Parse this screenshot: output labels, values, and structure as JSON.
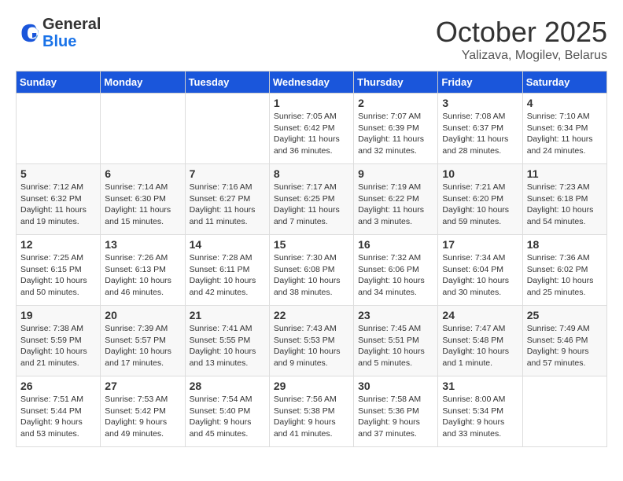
{
  "logo": {
    "general": "General",
    "blue": "Blue"
  },
  "title": "October 2025",
  "location": "Yalizava, Mogilev, Belarus",
  "days_of_week": [
    "Sunday",
    "Monday",
    "Tuesday",
    "Wednesday",
    "Thursday",
    "Friday",
    "Saturday"
  ],
  "weeks": [
    [
      {
        "day": "",
        "info": ""
      },
      {
        "day": "",
        "info": ""
      },
      {
        "day": "",
        "info": ""
      },
      {
        "day": "1",
        "info": "Sunrise: 7:05 AM\nSunset: 6:42 PM\nDaylight: 11 hours\nand 36 minutes."
      },
      {
        "day": "2",
        "info": "Sunrise: 7:07 AM\nSunset: 6:39 PM\nDaylight: 11 hours\nand 32 minutes."
      },
      {
        "day": "3",
        "info": "Sunrise: 7:08 AM\nSunset: 6:37 PM\nDaylight: 11 hours\nand 28 minutes."
      },
      {
        "day": "4",
        "info": "Sunrise: 7:10 AM\nSunset: 6:34 PM\nDaylight: 11 hours\nand 24 minutes."
      }
    ],
    [
      {
        "day": "5",
        "info": "Sunrise: 7:12 AM\nSunset: 6:32 PM\nDaylight: 11 hours\nand 19 minutes."
      },
      {
        "day": "6",
        "info": "Sunrise: 7:14 AM\nSunset: 6:30 PM\nDaylight: 11 hours\nand 15 minutes."
      },
      {
        "day": "7",
        "info": "Sunrise: 7:16 AM\nSunset: 6:27 PM\nDaylight: 11 hours\nand 11 minutes."
      },
      {
        "day": "8",
        "info": "Sunrise: 7:17 AM\nSunset: 6:25 PM\nDaylight: 11 hours\nand 7 minutes."
      },
      {
        "day": "9",
        "info": "Sunrise: 7:19 AM\nSunset: 6:22 PM\nDaylight: 11 hours\nand 3 minutes."
      },
      {
        "day": "10",
        "info": "Sunrise: 7:21 AM\nSunset: 6:20 PM\nDaylight: 10 hours\nand 59 minutes."
      },
      {
        "day": "11",
        "info": "Sunrise: 7:23 AM\nSunset: 6:18 PM\nDaylight: 10 hours\nand 54 minutes."
      }
    ],
    [
      {
        "day": "12",
        "info": "Sunrise: 7:25 AM\nSunset: 6:15 PM\nDaylight: 10 hours\nand 50 minutes."
      },
      {
        "day": "13",
        "info": "Sunrise: 7:26 AM\nSunset: 6:13 PM\nDaylight: 10 hours\nand 46 minutes."
      },
      {
        "day": "14",
        "info": "Sunrise: 7:28 AM\nSunset: 6:11 PM\nDaylight: 10 hours\nand 42 minutes."
      },
      {
        "day": "15",
        "info": "Sunrise: 7:30 AM\nSunset: 6:08 PM\nDaylight: 10 hours\nand 38 minutes."
      },
      {
        "day": "16",
        "info": "Sunrise: 7:32 AM\nSunset: 6:06 PM\nDaylight: 10 hours\nand 34 minutes."
      },
      {
        "day": "17",
        "info": "Sunrise: 7:34 AM\nSunset: 6:04 PM\nDaylight: 10 hours\nand 30 minutes."
      },
      {
        "day": "18",
        "info": "Sunrise: 7:36 AM\nSunset: 6:02 PM\nDaylight: 10 hours\nand 25 minutes."
      }
    ],
    [
      {
        "day": "19",
        "info": "Sunrise: 7:38 AM\nSunset: 5:59 PM\nDaylight: 10 hours\nand 21 minutes."
      },
      {
        "day": "20",
        "info": "Sunrise: 7:39 AM\nSunset: 5:57 PM\nDaylight: 10 hours\nand 17 minutes."
      },
      {
        "day": "21",
        "info": "Sunrise: 7:41 AM\nSunset: 5:55 PM\nDaylight: 10 hours\nand 13 minutes."
      },
      {
        "day": "22",
        "info": "Sunrise: 7:43 AM\nSunset: 5:53 PM\nDaylight: 10 hours\nand 9 minutes."
      },
      {
        "day": "23",
        "info": "Sunrise: 7:45 AM\nSunset: 5:51 PM\nDaylight: 10 hours\nand 5 minutes."
      },
      {
        "day": "24",
        "info": "Sunrise: 7:47 AM\nSunset: 5:48 PM\nDaylight: 10 hours\nand 1 minute."
      },
      {
        "day": "25",
        "info": "Sunrise: 7:49 AM\nSunset: 5:46 PM\nDaylight: 9 hours\nand 57 minutes."
      }
    ],
    [
      {
        "day": "26",
        "info": "Sunrise: 7:51 AM\nSunset: 5:44 PM\nDaylight: 9 hours\nand 53 minutes."
      },
      {
        "day": "27",
        "info": "Sunrise: 7:53 AM\nSunset: 5:42 PM\nDaylight: 9 hours\nand 49 minutes."
      },
      {
        "day": "28",
        "info": "Sunrise: 7:54 AM\nSunset: 5:40 PM\nDaylight: 9 hours\nand 45 minutes."
      },
      {
        "day": "29",
        "info": "Sunrise: 7:56 AM\nSunset: 5:38 PM\nDaylight: 9 hours\nand 41 minutes."
      },
      {
        "day": "30",
        "info": "Sunrise: 7:58 AM\nSunset: 5:36 PM\nDaylight: 9 hours\nand 37 minutes."
      },
      {
        "day": "31",
        "info": "Sunrise: 8:00 AM\nSunset: 5:34 PM\nDaylight: 9 hours\nand 33 minutes."
      },
      {
        "day": "",
        "info": ""
      }
    ]
  ]
}
